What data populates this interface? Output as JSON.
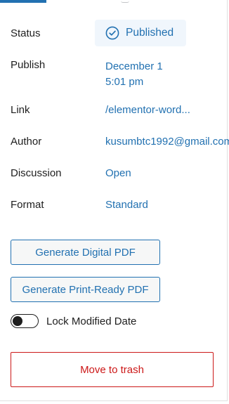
{
  "summary": {
    "status": {
      "label": "Status",
      "value": "Published"
    },
    "publish": {
      "label": "Publish",
      "date": "December 1",
      "time": "5:01 pm"
    },
    "link": {
      "label": "Link",
      "value": "/elementor-word..."
    },
    "author": {
      "label": "Author",
      "value": "kusumbtc1992@gmail.com"
    },
    "discussion": {
      "label": "Discussion",
      "value": "Open"
    },
    "format": {
      "label": "Format",
      "value": "Standard"
    }
  },
  "actions": {
    "digital_pdf_label": "Generate Digital PDF",
    "print_pdf_label": "Generate Print-Ready PDF",
    "lock_modified_date_label": "Lock Modified Date",
    "lock_modified_date_on": false,
    "trash_label": "Move to trash"
  },
  "colors": {
    "accent": "#2271b1",
    "destructive": "#cc1818",
    "status_bg": "#f0f6fc"
  }
}
